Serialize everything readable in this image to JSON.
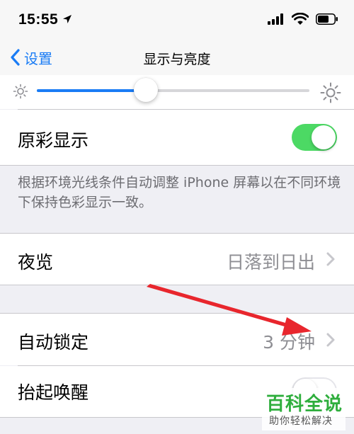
{
  "status_bar": {
    "time": "15:55"
  },
  "nav": {
    "back_label": "设置",
    "title": "显示与亮度"
  },
  "brightness": {
    "level": 0.4
  },
  "true_tone": {
    "label": "原彩显示",
    "enabled": true,
    "footer": "根据环境光线条件自动调整 iPhone 屏幕以在不同环境下保持色彩显示一致。"
  },
  "night_shift": {
    "label": "夜览",
    "value": "日落到日出"
  },
  "auto_lock": {
    "label": "自动锁定",
    "value": "3 分钟"
  },
  "raise_to_wake": {
    "label": "抬起唤醒",
    "enabled": false
  },
  "colors": {
    "accent": "#1a7cf5",
    "toggle_on": "#4cd964",
    "annotation_arrow": "#e8262d"
  },
  "watermark": {
    "title": "百科全说",
    "subtitle": "助你轻松解决"
  }
}
